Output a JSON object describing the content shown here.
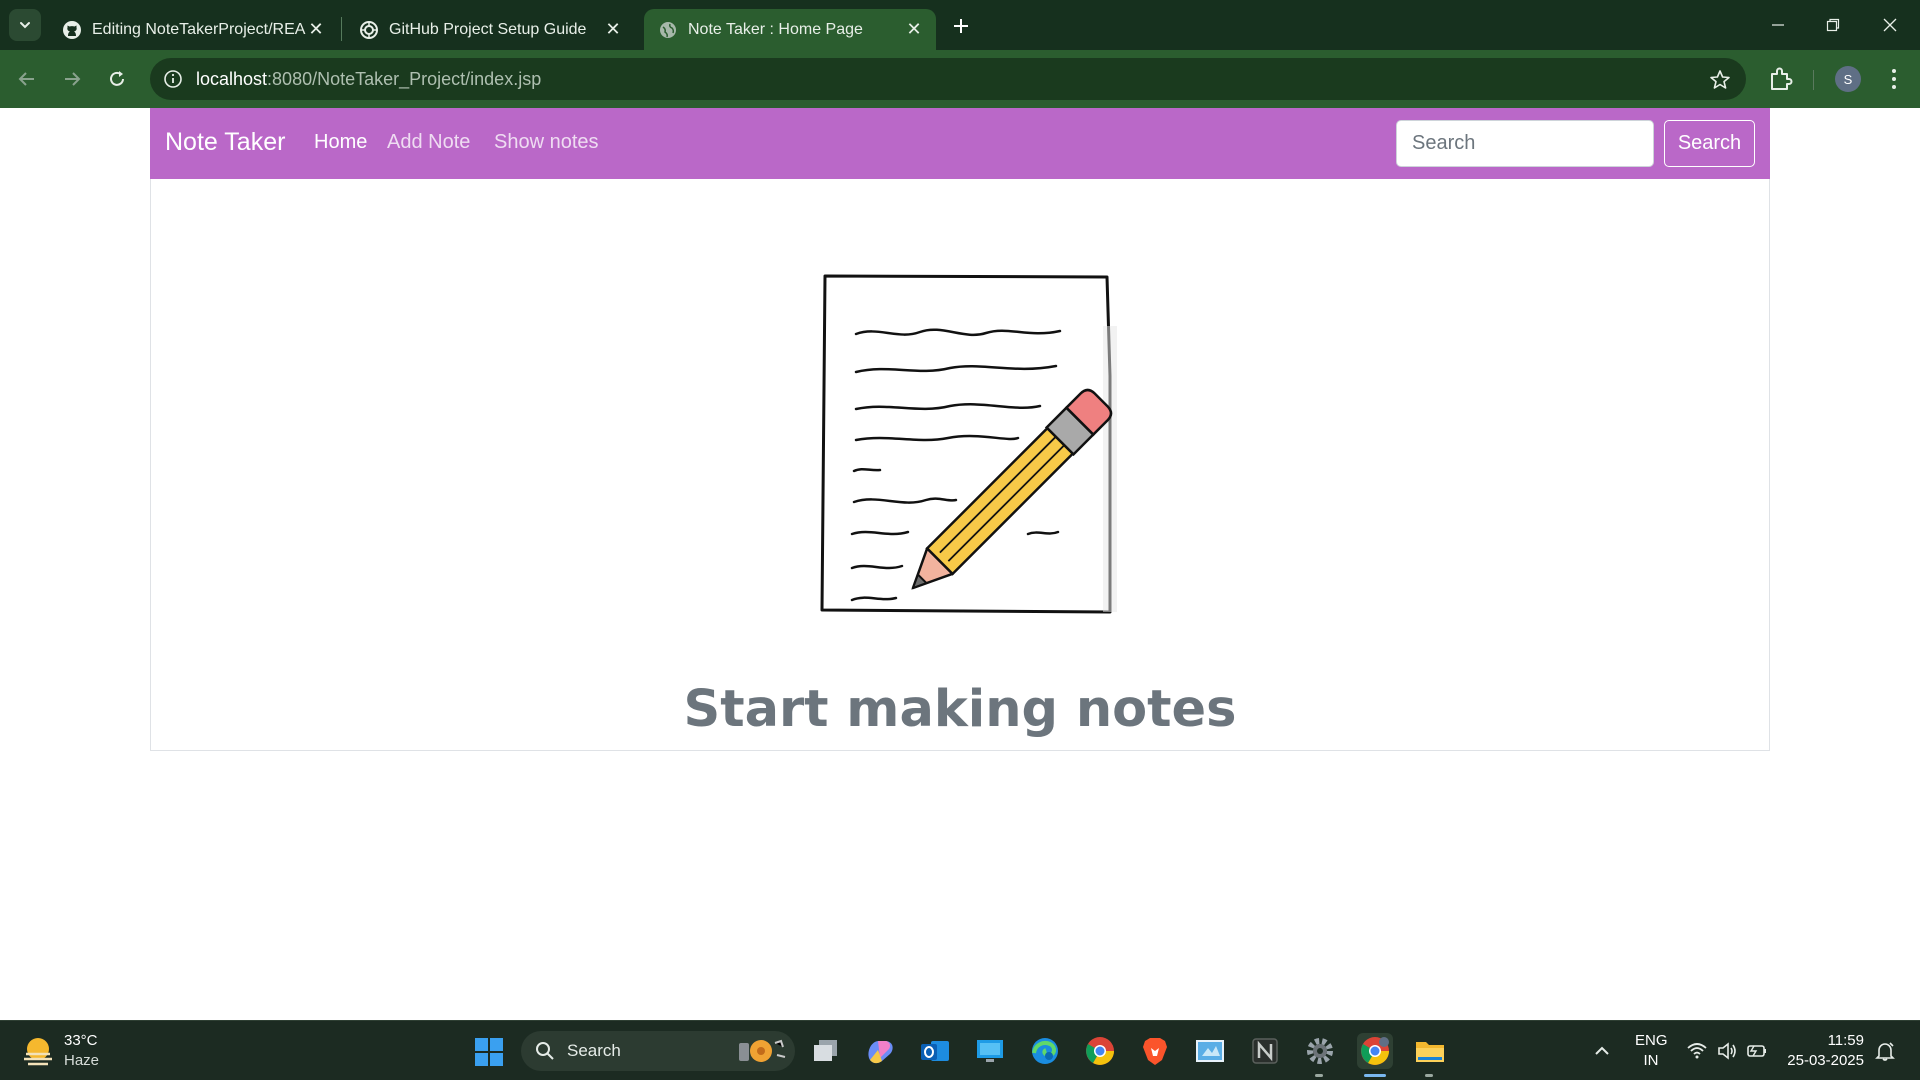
{
  "browser": {
    "tabs": [
      {
        "title": "Editing NoteTakerProject/READ",
        "icon": "github-icon",
        "active": false
      },
      {
        "title": "GitHub Project Setup Guide",
        "icon": "openai-icon",
        "active": false
      },
      {
        "title": "Note Taker : Home Page",
        "icon": "globe-icon",
        "active": true
      }
    ],
    "address": {
      "host": "localhost",
      "path": ":8080/NoteTaker_Project/index.jsp"
    },
    "profile_initial": "S",
    "theme_color": "#2b5d2f"
  },
  "app": {
    "brand": "Note Taker",
    "nav": {
      "home": "Home",
      "add_note": "Add Note",
      "show_notes": "Show notes"
    },
    "search": {
      "placeholder": "Search",
      "button": "Search"
    },
    "heading": "Start making notes",
    "navbar_color": "#ba68c8"
  },
  "taskbar": {
    "weather": {
      "temp": "33°C",
      "desc": "Haze"
    },
    "search_label": "Search",
    "apps": [
      "file-explorer-icon",
      "copilot-icon",
      "outlook-icon",
      "remote-desktop-icon",
      "edge-icon",
      "chrome-icon",
      "brave-icon",
      "control-panel-icon",
      "notion-icon",
      "settings-icon",
      "chrome-profile-icon",
      "folder-icon"
    ],
    "lang": {
      "line1": "ENG",
      "line2": "IN"
    },
    "clock": {
      "time": "11:59",
      "date": "25-03-2025"
    }
  }
}
